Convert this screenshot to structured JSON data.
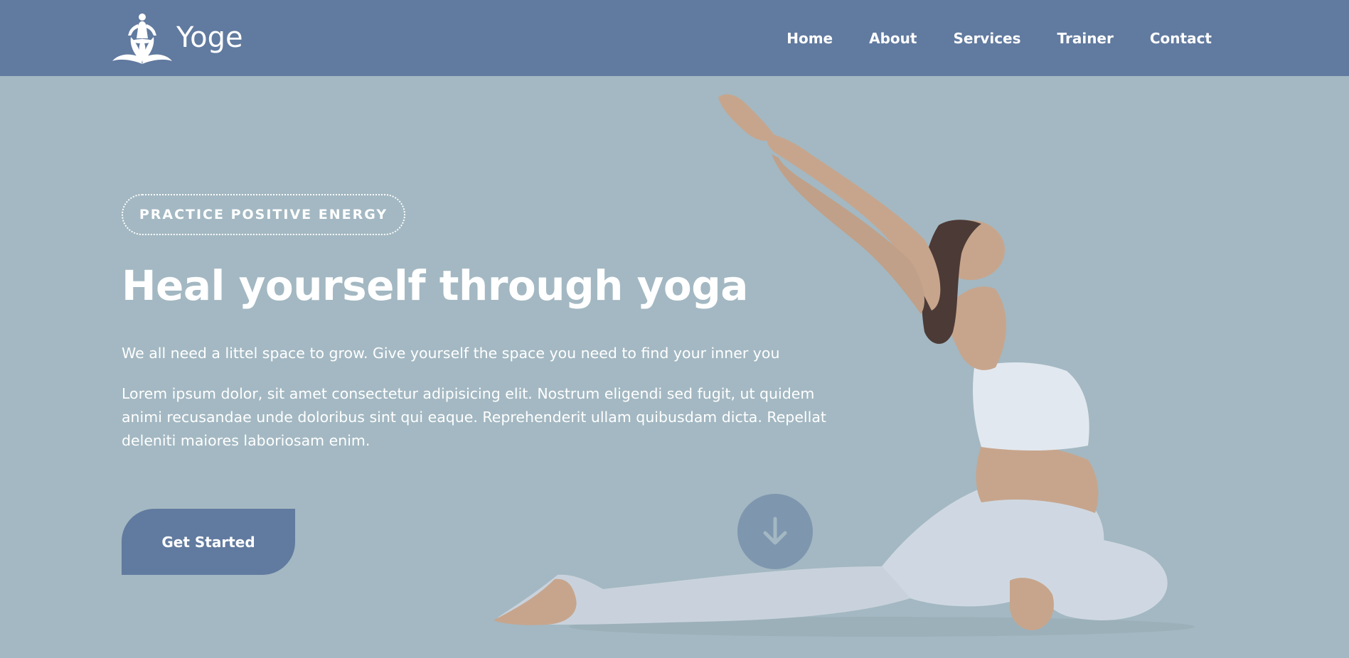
{
  "header": {
    "brand": "Yoge",
    "nav": [
      {
        "label": "Home"
      },
      {
        "label": "About"
      },
      {
        "label": "Services"
      },
      {
        "label": "Trainer"
      },
      {
        "label": "Contact"
      }
    ]
  },
  "hero": {
    "tagline": "PRACTICE POSITIVE ENERGY",
    "title": "Heal yourself through yoga",
    "subtitle": "We all need a littel space to grow. Give yourself the space you need to find your inner you",
    "body": "Lorem ipsum dolor, sit amet consectetur adipisicing elit. Nostrum eligendi sed fugit, ut quidem animi recusandae unde doloribus sint qui eaque. Reprehenderit ullam quibusdam dicta. Repellat deleniti maiores laboriosam enim.",
    "cta_label": "Get Started"
  },
  "icons": {
    "logo": "lotus-meditation-icon",
    "scroll": "arrow-down-icon"
  },
  "colors": {
    "header_bg": "#617a9f",
    "page_bg": "#a3b8c2",
    "button_bg": "#617a9f",
    "text": "#ffffff"
  }
}
